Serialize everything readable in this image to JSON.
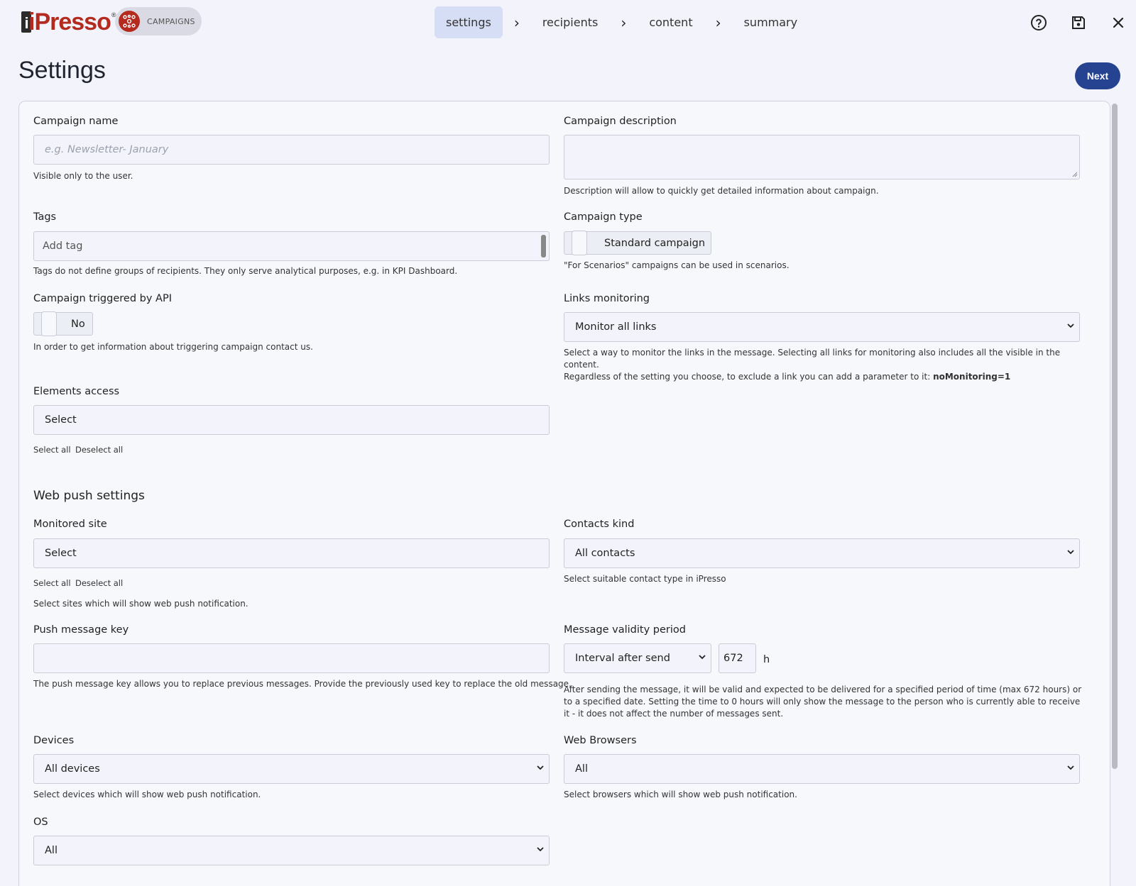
{
  "header": {
    "logo_text": "iPresso",
    "logo_mark": "®",
    "module_label": "CAMPAIGNS",
    "steps": [
      "settings",
      "recipients",
      "content",
      "summary"
    ],
    "icons": [
      "help-icon",
      "save-icon",
      "close-icon"
    ]
  },
  "page": {
    "title": "Settings",
    "next_label": "Next"
  },
  "form": {
    "campaign_name": {
      "label": "Campaign name",
      "placeholder": "e.g. Newsletter- January",
      "help": "Visible only to the user."
    },
    "campaign_description": {
      "label": "Campaign description",
      "help": "Description will allow to quickly get detailed information about campaign."
    },
    "tags": {
      "label": "Tags",
      "placeholder": "Add tag",
      "help": "Tags do not define groups of recipients. They only serve analytical purposes, e.g. in KPI Dashboard."
    },
    "campaign_type": {
      "label": "Campaign type",
      "value": "Standard campaign",
      "help": "\"For Scenarios\" campaigns can be used in scenarios."
    },
    "triggered_by_api": {
      "label": "Campaign triggered by API",
      "value": "No",
      "help": "In order to get information about triggering campaign contact us."
    },
    "links_monitoring": {
      "label": "Links monitoring",
      "value": "Monitor all links",
      "help_line1": "Select a way to monitor the links in the message. Selecting all links for monitoring also includes all the visible in the content.",
      "help_line2": "Regardless of the setting you choose, to exclude a link you can add a parameter to it: ",
      "help_bold": "noMonitoring=1"
    },
    "elements_access": {
      "label": "Elements access",
      "value": "Select",
      "select_all": "Select all",
      "deselect_all": "Deselect all"
    },
    "web_push_title": "Web push settings",
    "monitored_site": {
      "label": "Monitored site",
      "value": "Select",
      "select_all": "Select all",
      "deselect_all": "Deselect all",
      "help": "Select sites which will show web push notification."
    },
    "contacts_kind": {
      "label": "Contacts kind",
      "value": "All contacts",
      "help": "Select suitable contact type in iPresso"
    },
    "push_message_key": {
      "label": "Push message key",
      "help": "The push message key allows you to replace previous messages. Provide the previously used key to replace the old message."
    },
    "message_validity": {
      "label": "Message validity period",
      "mode": "Interval after send",
      "hours": "672",
      "unit": "h",
      "help": "After sending the message, it will be valid and expected to be delivered for a specified period of time (max 672 hours) or to a specified date. Setting the time to 0 hours will only show the message to the person who is currently able to receive it - it does not affect the number of messages sent."
    },
    "devices": {
      "label": "Devices",
      "value": "All devices",
      "help": "Select devices which will show web push notification."
    },
    "web_browsers": {
      "label": "Web Browsers",
      "value": "All",
      "help": "Select browsers which will show web push notification."
    },
    "os": {
      "label": "OS",
      "value": "All"
    }
  },
  "colors": {
    "brand_red": "#b52a1e",
    "primary_blue": "#264392",
    "active_step_bg": "#d6def5",
    "page_bg": "#f3f4fb"
  }
}
